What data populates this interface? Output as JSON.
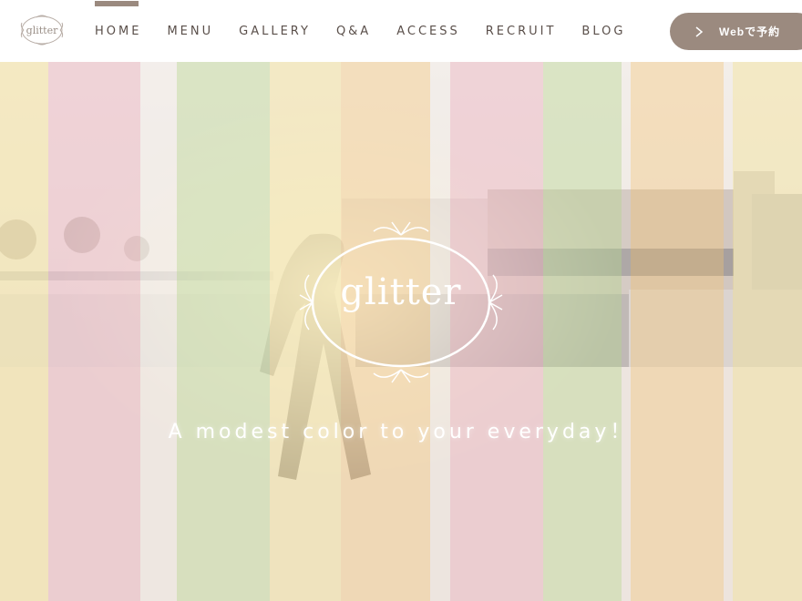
{
  "brand": {
    "logo_text": "glitter"
  },
  "nav": {
    "items": [
      {
        "label": "HOME"
      },
      {
        "label": "MENU"
      },
      {
        "label": "GALLERY"
      },
      {
        "label": "Q&A"
      },
      {
        "label": "ACCESS"
      },
      {
        "label": "RECRUIT"
      },
      {
        "label": "BLOG"
      }
    ],
    "active": "HOME"
  },
  "reserve": {
    "label": "Webで予約"
  },
  "hero": {
    "emblem_text": "glitter",
    "tagline": "A modest color to your everyday！"
  },
  "colors": {
    "accent": "#9b8a7f",
    "nav_text": "#5a4f4a",
    "stripe_yellow": "#f3e7b3",
    "stripe_pink": "#ecc5d0",
    "stripe_white": "#f2eeee",
    "stripe_green": "#cfe0b6",
    "stripe_peach": "#f2d6a8"
  }
}
